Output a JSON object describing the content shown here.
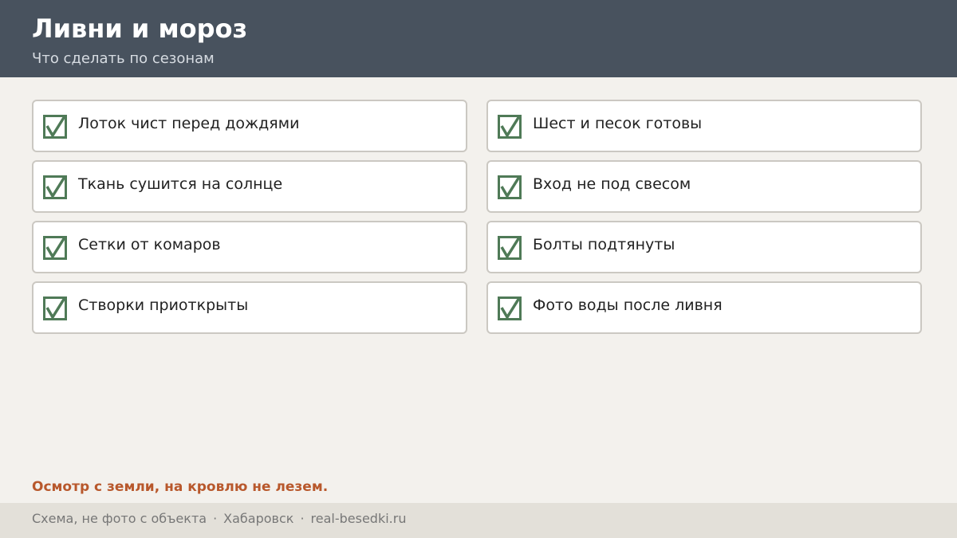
{
  "header": {
    "title": "Ливни и мороз",
    "subtitle": "Что сделать по сезонам"
  },
  "checklist": [
    {
      "label": "Лоток чист перед дождями",
      "checked": true
    },
    {
      "label": "Шест и песок готовы",
      "checked": true
    },
    {
      "label": "Ткань сушится на солнце",
      "checked": true
    },
    {
      "label": "Вход не под свесом",
      "checked": true
    },
    {
      "label": "Сетки от комаров",
      "checked": true
    },
    {
      "label": "Болты подтянуты",
      "checked": true
    },
    {
      "label": "Створки приоткрыты",
      "checked": true
    },
    {
      "label": "Фото воды после ливня",
      "checked": true
    }
  ],
  "note": "Осмотр с земли, на кровлю не лезем.",
  "footer": {
    "disclaimer": "Схема, не фото с объекта",
    "separator": "·",
    "city": "Хабаровск",
    "site": "real-besedki.ru"
  },
  "colors": {
    "header_bg": "#48525e",
    "check_green": "#4f7a57",
    "note_accent": "#b8582c"
  },
  "icons": {
    "check": "checkbox-checked-icon"
  }
}
